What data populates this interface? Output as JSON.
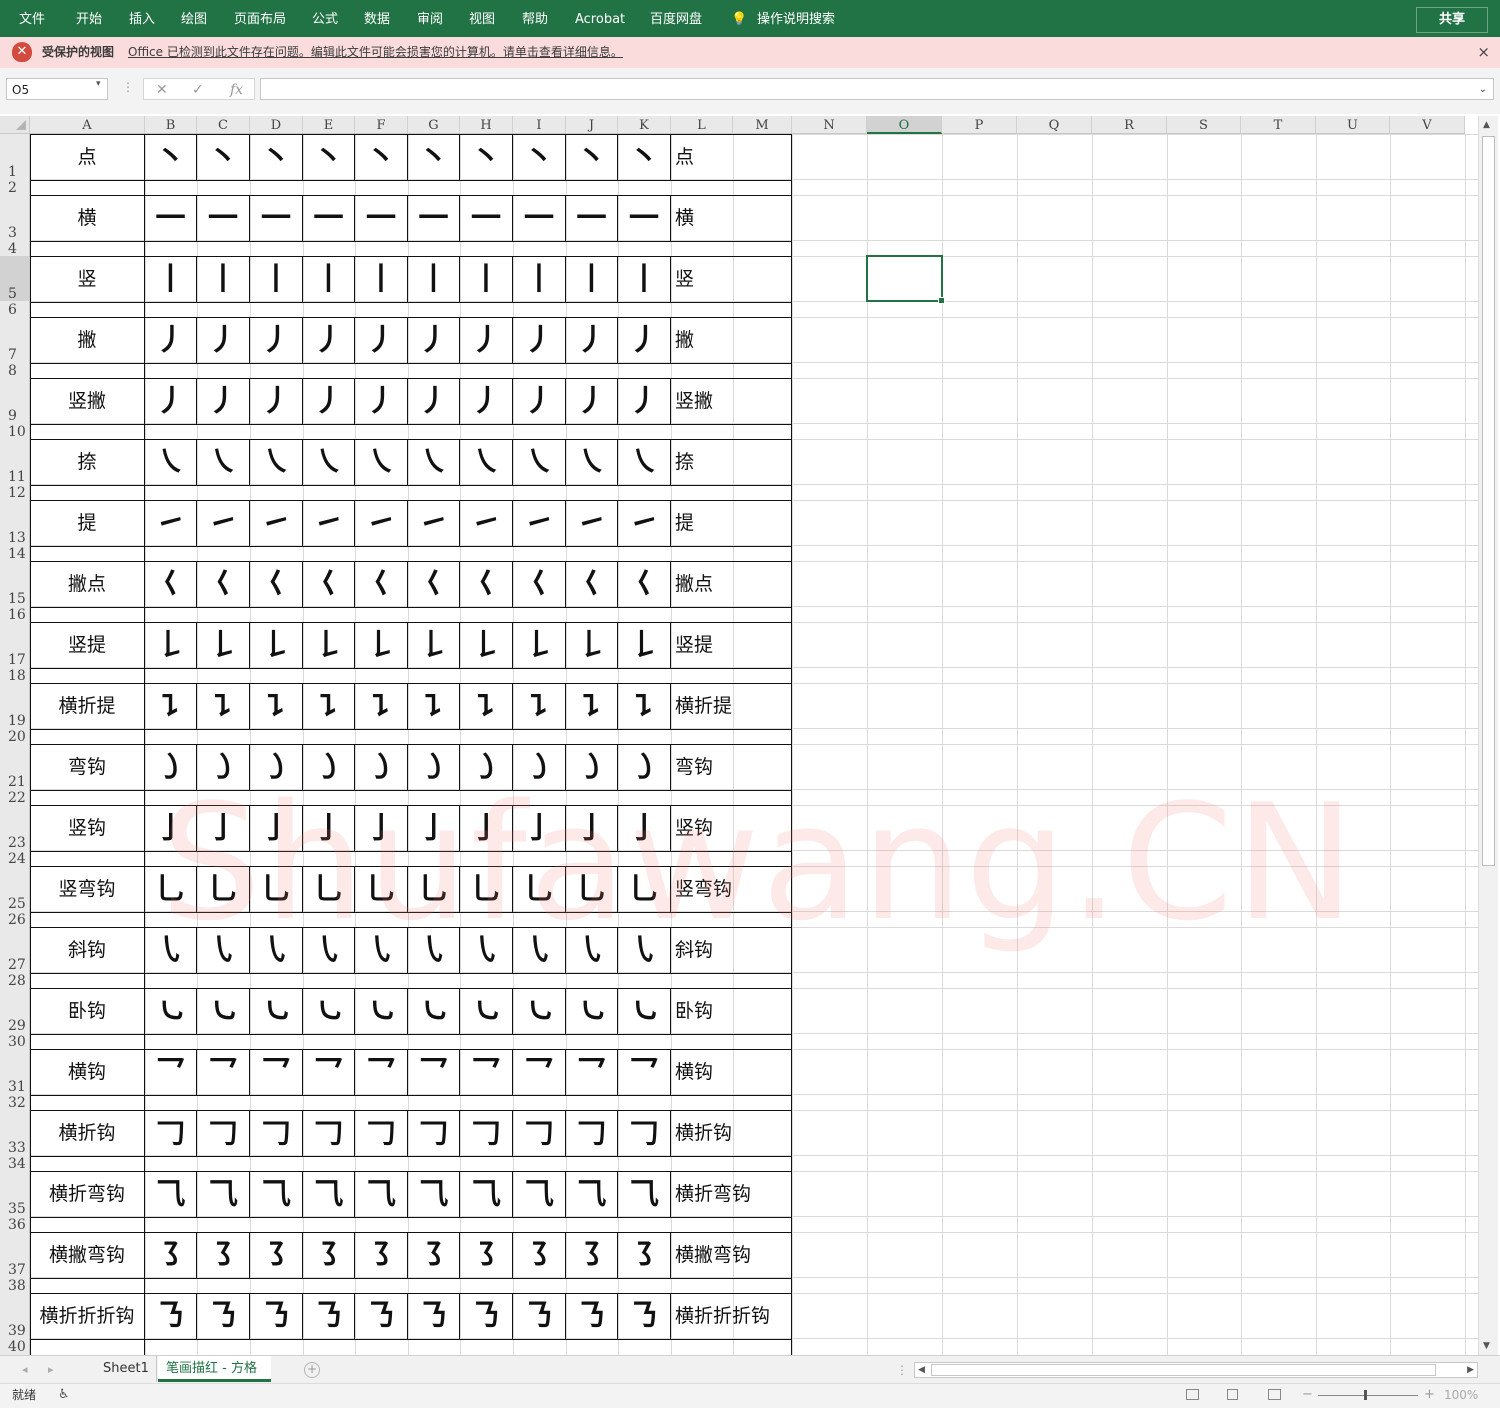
{
  "ribbon": {
    "tabs": [
      "文件",
      "开始",
      "插入",
      "绘图",
      "页面布局",
      "公式",
      "数据",
      "审阅",
      "视图",
      "帮助",
      "Acrobat",
      "百度网盘"
    ],
    "search_label": "操作说明搜索",
    "share_label": "共享"
  },
  "protected_view": {
    "title": "受保护的视图",
    "message": "Office 已检测到此文件存在问题。编辑此文件可能会损害您的计算机。请单击查看详细信息。",
    "close_glyph": "×"
  },
  "formula_bar": {
    "name_box": "O5",
    "cancel_glyph": "✕",
    "enter_glyph": "✓",
    "fx_label": "fx",
    "value": ""
  },
  "columns": [
    "A",
    "B",
    "C",
    "D",
    "E",
    "F",
    "G",
    "H",
    "I",
    "J",
    "K",
    "L",
    "M",
    "N",
    "O",
    "P",
    "Q",
    "R",
    "S",
    "T",
    "U",
    "V"
  ],
  "selected_column": "O",
  "selected_cell": "O5",
  "row_numbers": [
    "1",
    "2",
    "3",
    "4",
    "5",
    "6",
    "7",
    "8",
    "9",
    "10",
    "11",
    "12",
    "13",
    "14",
    "15",
    "16",
    "17",
    "18",
    "19",
    "20",
    "21",
    "22",
    "23",
    "24",
    "25",
    "26",
    "27",
    "28",
    "29",
    "30",
    "31",
    "32",
    "33",
    "34",
    "35",
    "36",
    "37",
    "38",
    "39",
    "40"
  ],
  "strokes": [
    {
      "name": "点",
      "glyph": "丶"
    },
    {
      "name": "横",
      "glyph": "一"
    },
    {
      "name": "竖",
      "glyph": "丨"
    },
    {
      "name": "撇",
      "glyph": "丿"
    },
    {
      "name": "竖撇",
      "glyph": "丿"
    },
    {
      "name": "捺",
      "glyph": "㇏"
    },
    {
      "name": "提",
      "glyph": "㇀"
    },
    {
      "name": "撇点",
      "glyph": "𡿨"
    },
    {
      "name": "竖提",
      "glyph": "𠄌"
    },
    {
      "name": "横折提",
      "glyph": "㇊"
    },
    {
      "name": "弯钩",
      "glyph": "㇁"
    },
    {
      "name": "竖钩",
      "glyph": "亅"
    },
    {
      "name": "竖弯钩",
      "glyph": "乚"
    },
    {
      "name": "斜钩",
      "glyph": "㇂"
    },
    {
      "name": "卧钩",
      "glyph": "㇃"
    },
    {
      "name": "横钩",
      "glyph": "乛"
    },
    {
      "name": "横折钩",
      "glyph": "𠃌"
    },
    {
      "name": "横折弯钩",
      "glyph": "⺄"
    },
    {
      "name": "横撇弯钩",
      "glyph": "㇌"
    },
    {
      "name": "横折折折钩",
      "glyph": "㇡"
    }
  ],
  "watermark": "Shufawang.CN",
  "sheet_tabs": [
    "Sheet1",
    "笔画描红 - 方格"
  ],
  "active_sheet": "笔画描红 - 方格",
  "add_sheet_glyph": "+",
  "status": {
    "ready": "就绪",
    "zoom": "100%"
  }
}
